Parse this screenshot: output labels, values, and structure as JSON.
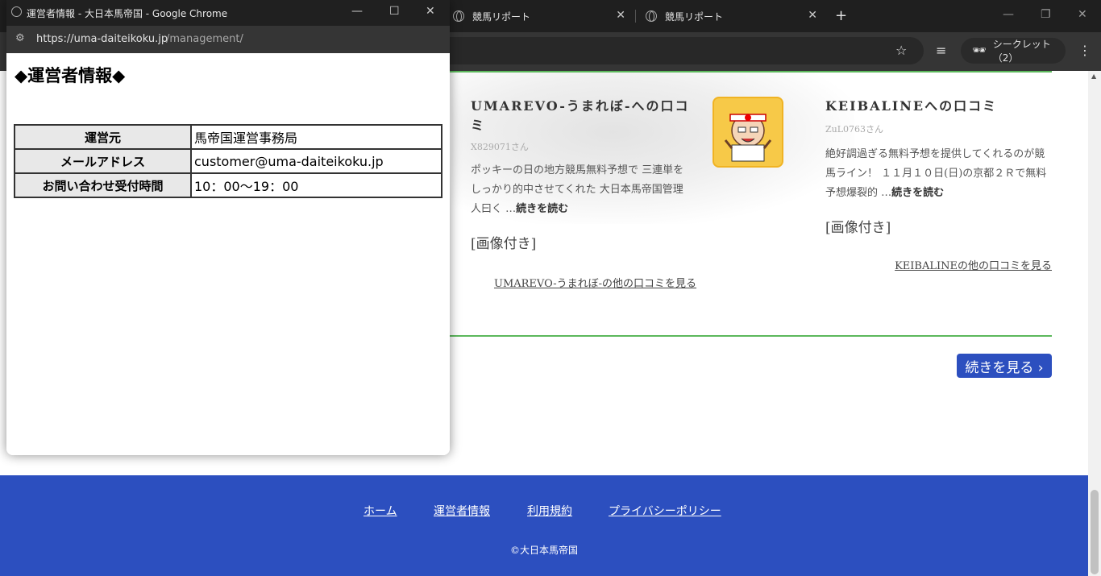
{
  "browser": {
    "tabs": [
      {
        "label": "競馬リポート"
      },
      {
        "label": "競馬リポート"
      }
    ],
    "incognito_label": "シークレット（2）"
  },
  "page": {
    "reviews": [
      {
        "title": "UMAREVO-うまれぼ-への口コミ",
        "user": "X829071さん",
        "body": "ポッキーの日の地方競馬無料予想で 三連単をしっかり的中させてくれた 大日本馬帝国管理人曰く …",
        "read_more": "続きを読む",
        "image_note": "[画像付き]",
        "other_link": "UMAREVO-うまれぼ-の他の口コミを見る"
      },
      {
        "title": "KEIBALINEへの口コミ",
        "user": "ZuL0763さん",
        "body": "絶好調過ぎる無料予想を提供してくれるのが競馬ライン！ １１月１０日(日)の京都２Ｒで無料予想爆裂的 …",
        "read_more": "続きを読む",
        "image_note": "[画像付き]",
        "other_link": "KEIBALINEの他の口コミを見る"
      }
    ],
    "more_button": "続きを見る ›",
    "footer": {
      "links": [
        "ホーム",
        "運営者情報",
        "利用規約",
        "プライバシーポリシー"
      ],
      "copyright": "©大日本馬帝国"
    },
    "accent_color": "#2c4fbf",
    "divider_color": "#5cb85c"
  },
  "popup": {
    "window_title": "運営者情報 - 大日本馬帝国 - Google Chrome",
    "url_domain": "https://uma-daiteikoku.jp",
    "url_path": "/management/",
    "heading": "◆運営者情報◆",
    "table": [
      {
        "label": "運営元",
        "value": "馬帝国運営事務局"
      },
      {
        "label": "メールアドレス",
        "value": "customer@uma-daiteikoku.jp"
      },
      {
        "label": "お問い合わせ受付時間",
        "value": "10：00〜19：00"
      }
    ]
  }
}
